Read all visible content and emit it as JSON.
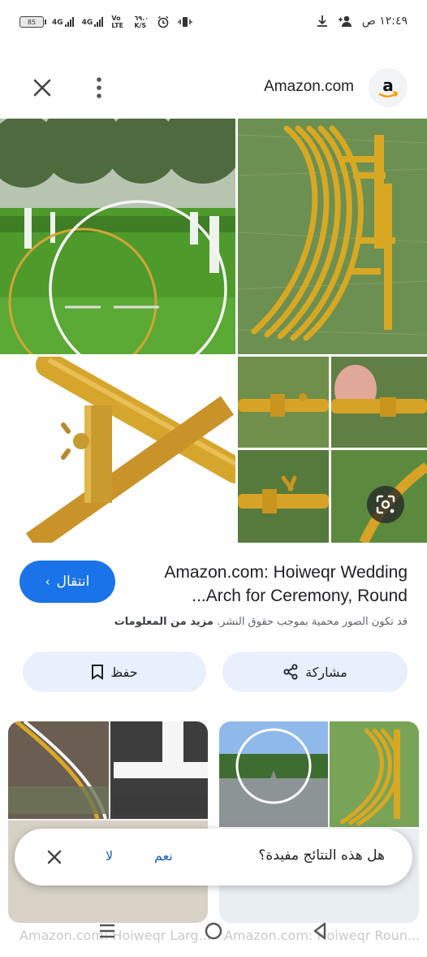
{
  "status": {
    "battery": "85",
    "net1": "4G",
    "net2": "4G",
    "volte": "Vo LTE",
    "speed": "٦٩.٠ K/S",
    "time": "١٢:٤٩ ص"
  },
  "header": {
    "site_name": "Amazon.com",
    "logo_letter": "a"
  },
  "result": {
    "title": "Amazon.com: Hoiweqr Wedding Arch for Ceremony, Round...",
    "title_line1": "Amazon.com: Hoiweqr Wedding",
    "title_line2": "...Arch for Ceremony, Round",
    "goto_label": "انتقال",
    "copyright_text": "قد تكون الصور محمية بموجب حقوق النشر.",
    "more_info": "مزيد من المعلومات",
    "save_label": "حفظ",
    "share_label": "مشاركة"
  },
  "related": [
    {
      "caption": "Amazon.com: Hoiweqr Roun..."
    },
    {
      "caption": "Amazon.com: Hoiweqr Larg..."
    }
  ],
  "feedback": {
    "question": "هل هذه النتائج مفيدة؟",
    "yes": "نعم",
    "no": "لا"
  },
  "icons": {
    "close": "close-icon",
    "more": "more-vert-icon",
    "lens": "lens-icon",
    "share": "share-icon",
    "bookmark": "bookmark-icon"
  },
  "colors": {
    "accent": "#1a73e8",
    "tonal_button": "#e8f0fe",
    "gold": "#d4a017",
    "grass": "#4e8f2e"
  }
}
